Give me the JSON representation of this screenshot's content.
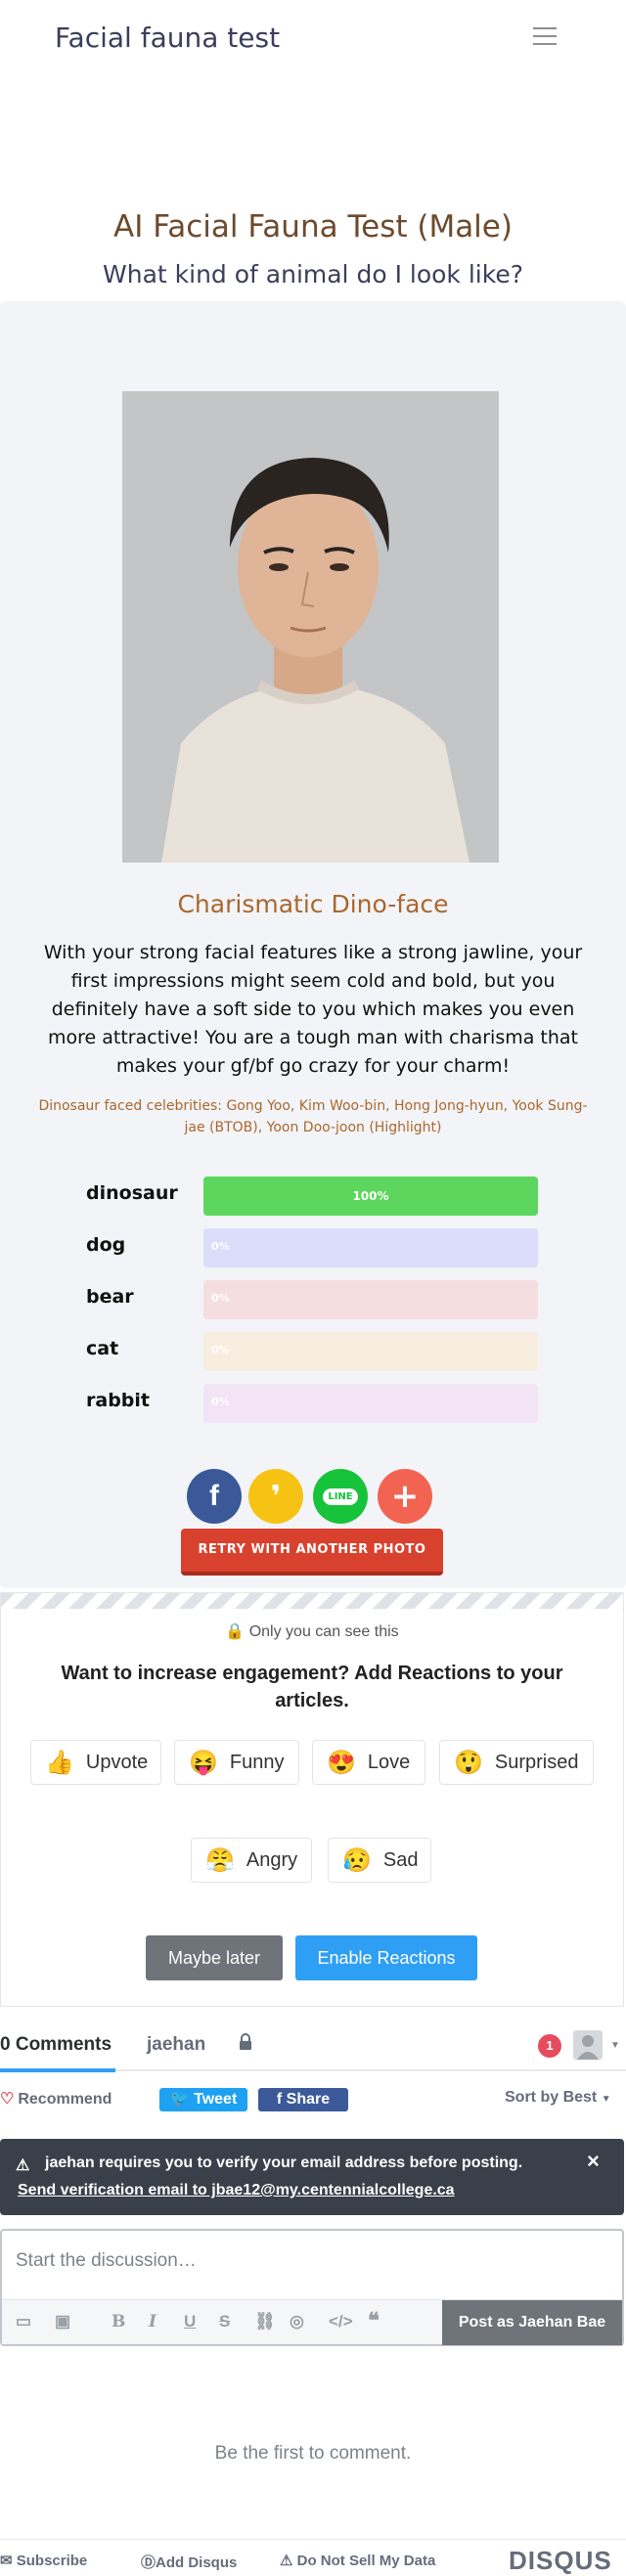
{
  "header": {
    "brand": "Facial fauna test",
    "menu_icon": "hamburger-menu-icon"
  },
  "page": {
    "title": "AI Facial Fauna Test (Male)",
    "subtitle": "What kind of animal do I look like?"
  },
  "result": {
    "title": "Charismatic Dino-face",
    "description": "With your strong facial features like a strong jawline, your first impressions might seem cold and bold, but you definitely have a soft side to you which makes you even more attractive! You are a tough man with charisma that makes your gf/bf go crazy for your charm!",
    "celebrities": "Dinosaur faced celebrities: Gong Yoo, Kim Woo-bin, Hong Jong-hyun, Yook Sung-jae (BTOB), Yoon Doo-joon (Highlight)"
  },
  "scores": [
    {
      "label": "dinosaur",
      "percent_text": "100%",
      "value": 100,
      "color": "#5cd65c",
      "track": "#5cd65c"
    },
    {
      "label": "dog",
      "percent_text": "0%",
      "value": 0,
      "color": "#c8c9f5",
      "track": "#dcdcfb"
    },
    {
      "label": "bear",
      "percent_text": "0%",
      "value": 0,
      "color": "#f2c2c6",
      "track": "#f6dde0"
    },
    {
      "label": "cat",
      "percent_text": "0%",
      "value": 0,
      "color": "#f5e4cd",
      "track": "#f8eedf"
    },
    {
      "label": "rabbit",
      "percent_text": "0%",
      "value": 0,
      "color": "#f0dcf3",
      "track": "#f2e3f5"
    }
  ],
  "share": {
    "facebook_color": "#3b5998",
    "kakao_color": "#f6c315",
    "line_label": "LINE",
    "line_color": "#17c33b",
    "more_color": "#f26451"
  },
  "retry_label": "RETRY WITH ANOTHER PHOTO",
  "reactions": {
    "only_you": "Only you can see this",
    "prompt": "Want to increase engagement? Add Reactions to your articles.",
    "items": [
      {
        "emoji": "👍",
        "label": "Upvote"
      },
      {
        "emoji": "😝",
        "label": "Funny"
      },
      {
        "emoji": "😍",
        "label": "Love"
      },
      {
        "emoji": "😲",
        "label": "Surprised"
      },
      {
        "emoji": "😤",
        "label": "Angry"
      },
      {
        "emoji": "😥",
        "label": "Sad"
      }
    ],
    "later_label": "Maybe later",
    "enable_label": "Enable Reactions"
  },
  "disqus": {
    "tab_comments": "0 Comments",
    "tab_user": "jaehan",
    "notifications": "1",
    "recommend": "Recommend",
    "tweet": "Tweet",
    "share": "Share",
    "sort": "Sort by Best",
    "alert_message": "jaehan requires you to verify your email address before posting.",
    "alert_link": "Send verification email to jbae12@my.centennialcollege.ca",
    "placeholder": "Start the discussion…",
    "post_button": "Post as Jaehan Bae",
    "empty_text": "Be the first to comment.",
    "footer": {
      "subscribe": "Subscribe",
      "add_disqus": "Add Disqus",
      "do_not_sell": "Do Not Sell My Data",
      "logo": "DISQUS"
    }
  }
}
